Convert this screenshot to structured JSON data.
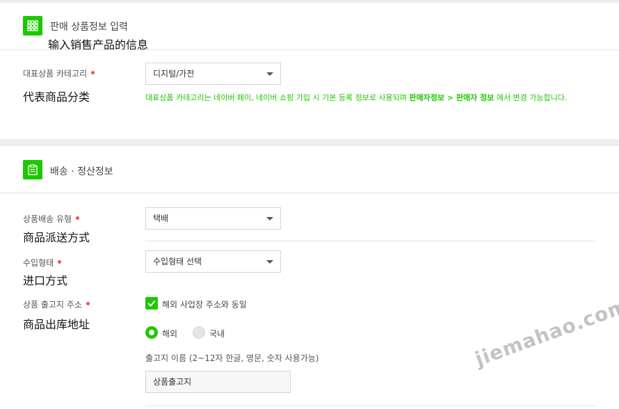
{
  "section1": {
    "title": "판매 상품정보 입력",
    "subtitle": "输入销售产品的信息",
    "icon": "grid-icon"
  },
  "category": {
    "label": "대표상품 카테고리",
    "cn_label": "代表商品分类",
    "value": "디지털/가전",
    "notice_pre": "대표상품 카테고리는 네이버 페이, 네이버 쇼핑 가입 시 기본 등록 정보로 사용되며 ",
    "notice_bold": "판매자정보 > 판매자 정보",
    "notice_post": " 에서 변경 가능합니다."
  },
  "section2": {
    "title": "배송 · 정산정보",
    "icon": "clipboard-icon"
  },
  "delivery_type": {
    "label": "상품배송 유형",
    "cn_label": "商品派送方式",
    "value": "택배"
  },
  "import_type": {
    "label": "수입형태",
    "cn_label": "进口方式",
    "value": "수입형태 선택"
  },
  "shipping_address": {
    "label": "상품 출고지 주소",
    "cn_label": "商品出库地址",
    "checkbox_label": "해외 사업장 주소와 동일",
    "radio_overseas": "해외",
    "radio_domestic": "국내",
    "name_hint": "출고지 이름 (2~12자 한글, 영문, 숫자 사용가능)",
    "name_value": "상품출고지"
  },
  "watermark": "jiemahao.com",
  "colors": {
    "accent": "#1ec800",
    "required": "#f05050"
  }
}
